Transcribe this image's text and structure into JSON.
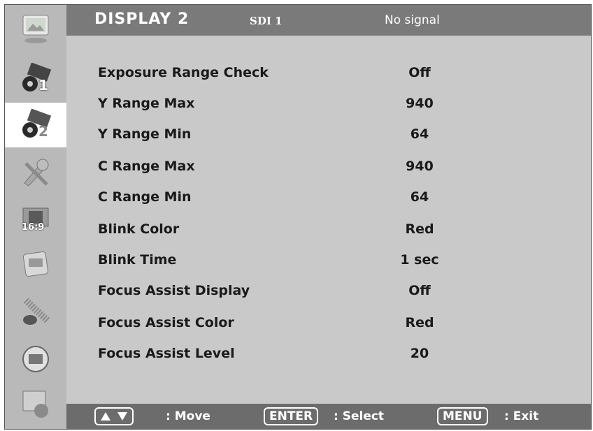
{
  "header": {
    "title": "DISPLAY 2",
    "source": "SDI 1",
    "status": "No signal"
  },
  "sidebar": {
    "items": [
      {
        "name": "picture-icon",
        "badge": ""
      },
      {
        "name": "display-1-icon",
        "badge": "1"
      },
      {
        "name": "display-2-icon",
        "badge": "2",
        "active": true
      },
      {
        "name": "setup-tools-icon",
        "badge": ""
      },
      {
        "name": "aspect-ratio-icon",
        "badge": "16:9"
      },
      {
        "name": "osd-icon",
        "badge": ""
      },
      {
        "name": "audio-icon",
        "badge": ""
      },
      {
        "name": "system-icon",
        "badge": ""
      },
      {
        "name": "user-icon",
        "badge": ""
      }
    ]
  },
  "menu": {
    "items": [
      {
        "label": "Exposure Range Check",
        "value": "Off"
      },
      {
        "label": "Y Range Max",
        "value": "940"
      },
      {
        "label": "Y Range Min",
        "value": "64"
      },
      {
        "label": "C Range Max",
        "value": "940"
      },
      {
        "label": "C Range Min",
        "value": "64"
      },
      {
        "label": "Blink Color",
        "value": "Red"
      },
      {
        "label": "Blink Time",
        "value": "1 sec"
      },
      {
        "label": "Focus Assist Display",
        "value": "Off"
      },
      {
        "label": "Focus Assist Color",
        "value": "Red"
      },
      {
        "label": "Focus Assist Level",
        "value": "20"
      }
    ]
  },
  "footer": {
    "move_text": ": Move",
    "enter_key": "ENTER",
    "select_text": ": Select",
    "menu_key": "MENU",
    "exit_text": ": Exit"
  },
  "colors": {
    "active_bg": "#ffffff",
    "header_bg": "#7a7a7a",
    "panel_bg": "#c9c9c9",
    "footer_bg": "#6c6c6c"
  }
}
